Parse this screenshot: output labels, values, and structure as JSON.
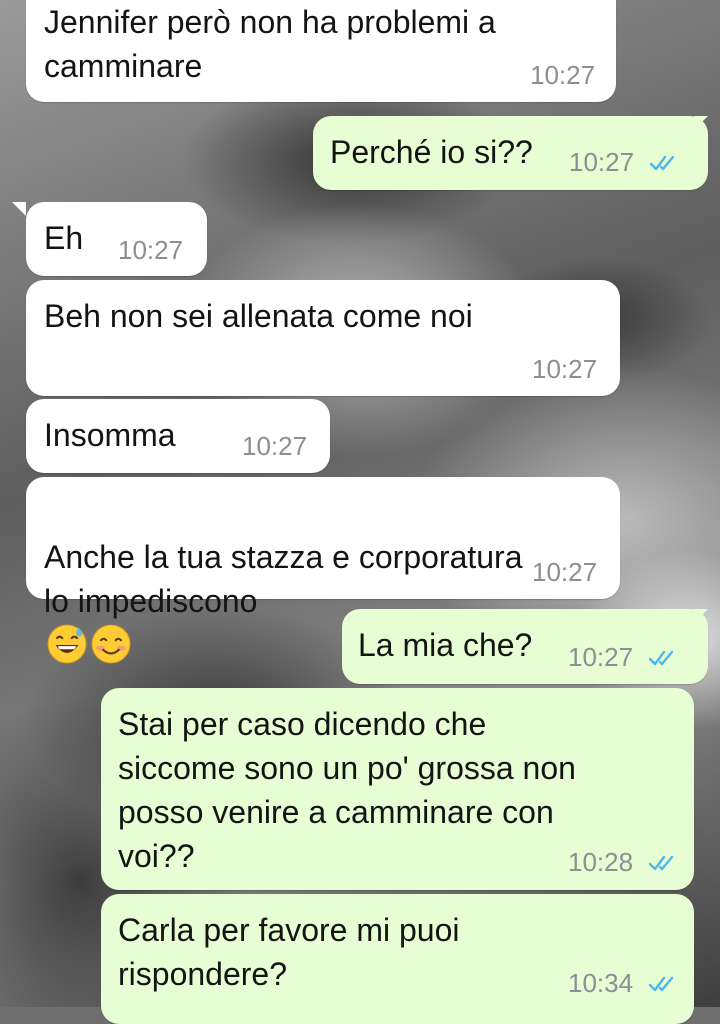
{
  "chat": {
    "messages": [
      {
        "direction": "in",
        "text": "Jennifer però non ha problemi a\ncamminare",
        "time": "10:27"
      },
      {
        "direction": "out",
        "text": "Perché io si??",
        "time": "10:27",
        "status": "read-double-check-icon"
      },
      {
        "direction": "in",
        "text": "Eh",
        "time": "10:27"
      },
      {
        "direction": "in",
        "text": "Beh non sei allenata come noi",
        "time": "10:27"
      },
      {
        "direction": "in",
        "text": "Insomma",
        "time": "10:27"
      },
      {
        "direction": "in",
        "text": "Anche la tua stazza e corporatura\nlo impediscono",
        "time": "10:27",
        "emojis": [
          "grinning-sweat-emoji",
          "smiling-eyes-emoji"
        ]
      },
      {
        "direction": "out",
        "text": "La mia che?",
        "time": "10:27",
        "status": "read-double-check-icon"
      },
      {
        "direction": "out",
        "text": "Stai per caso dicendo che\nsiccome sono un po' grossa non\nposso venire a camminare con\nvoi??",
        "time": "10:28",
        "status": "read-double-check-icon"
      },
      {
        "direction": "out",
        "text": "Carla per favore mi puoi\nrispondere?",
        "time": "10:34",
        "status": "read-double-check-icon"
      }
    ]
  },
  "colors": {
    "incoming_bubble": "#ffffff",
    "outgoing_bubble": "#e7fed4",
    "text": "#141414",
    "timestamp": "#8a8f92",
    "read_ticks": "#4fb6ec"
  }
}
